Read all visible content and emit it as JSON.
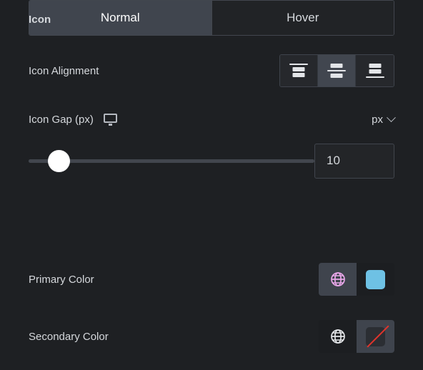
{
  "section": {
    "title": "Icon"
  },
  "alignment": {
    "label": "Icon Alignment",
    "options": [
      {
        "name": "align-top",
        "icon": "align-top-icon",
        "selected": false
      },
      {
        "name": "align-middle",
        "icon": "align-middle-icon",
        "selected": true
      },
      {
        "name": "align-bottom",
        "icon": "align-bottom-icon",
        "selected": false
      }
    ]
  },
  "icon_gap": {
    "label": "Icon Gap (px)",
    "device_icon": "desktop-monitor-icon",
    "unit": "px",
    "unit_chevron": "chevron-down-icon",
    "value": "10",
    "slider": {
      "percent": 10,
      "min": 0,
      "max": 100
    }
  },
  "state_tabs": {
    "tabs": [
      {
        "label": "Normal",
        "active": true
      },
      {
        "label": "Hover",
        "active": false
      }
    ]
  },
  "primary_color": {
    "label": "Primary Color",
    "globe_icon": "globe-icon",
    "globe_color": "#e8a6e8",
    "swatch_color": "#6ec1e4"
  },
  "secondary_color": {
    "label": "Secondary Color",
    "globe_icon": "globe-icon",
    "globe_color": "#e3e5e8",
    "swatch_color": "none",
    "swatch_empty_slash_color": "#e1342c"
  },
  "theme": {
    "background": "#1e2023",
    "text": "#d5d8dc",
    "accent_selected": "#40454e"
  }
}
